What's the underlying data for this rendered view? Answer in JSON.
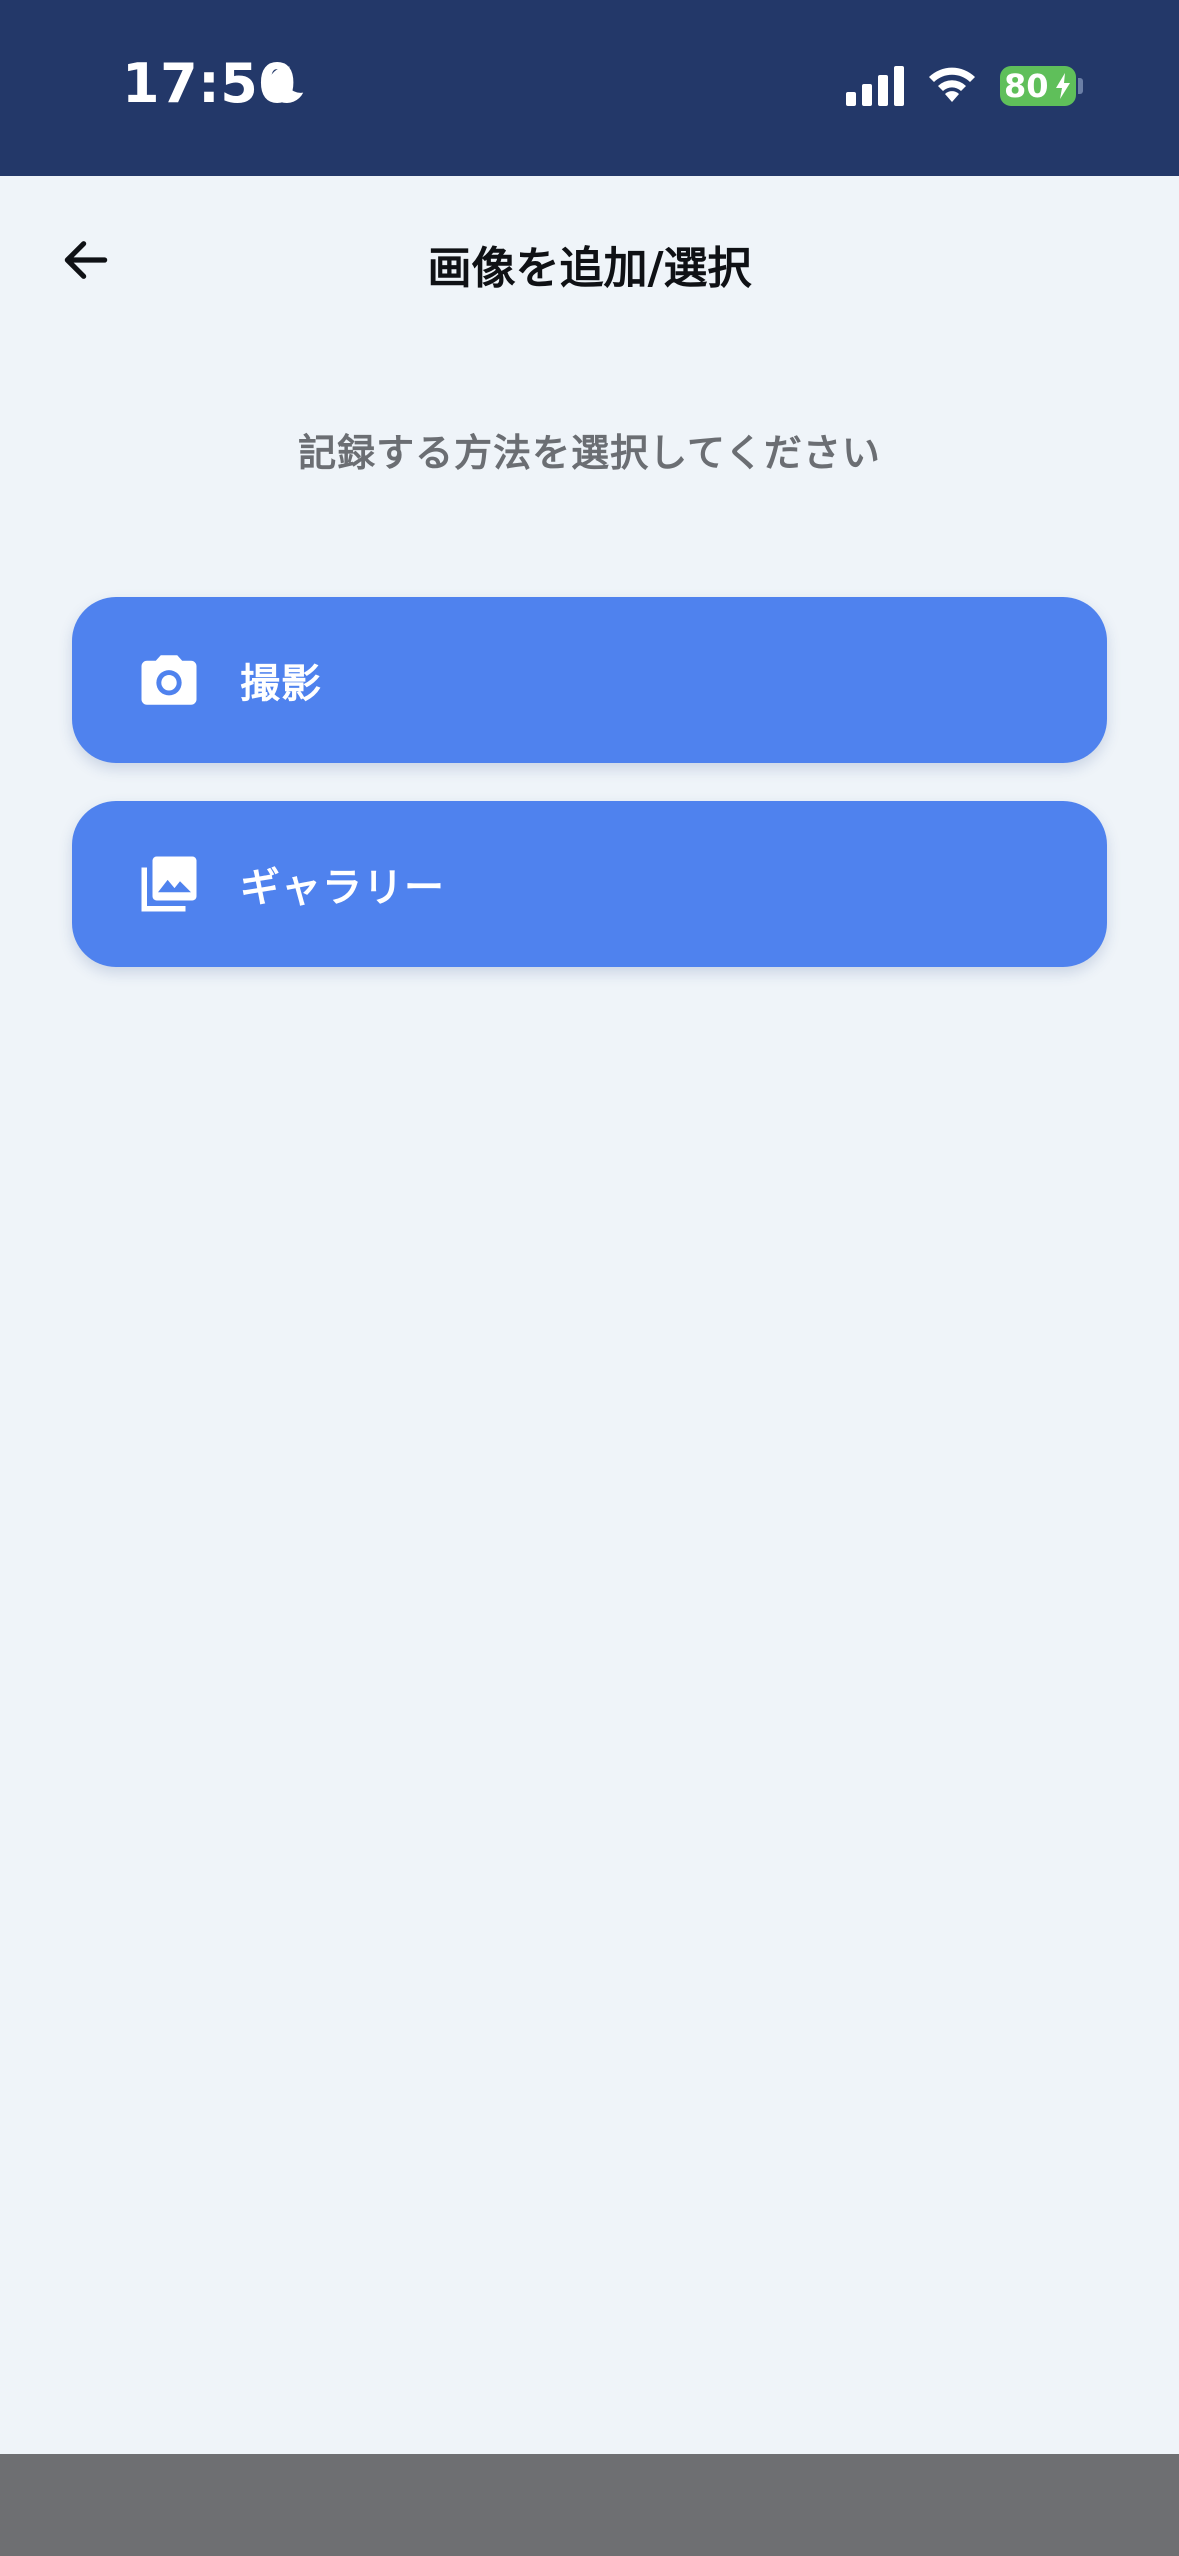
{
  "status_bar": {
    "time": "17:50",
    "battery_level": "80",
    "icons": [
      "moon-icon",
      "signal-icon",
      "wifi-icon",
      "battery-icon"
    ]
  },
  "header": {
    "title": "画像を追加/選択",
    "back_icon": "arrow-left-icon"
  },
  "main": {
    "subtitle": "記録する方法を選択してください",
    "options": [
      {
        "label": "撮影",
        "icon": "camera-icon"
      },
      {
        "label": "ギャラリー",
        "icon": "gallery-icon"
      }
    ]
  },
  "colors": {
    "status_bar_bg": "#233869",
    "page_bg": "#eff4f9",
    "button_bg": "#4f82ee",
    "battery_green": "#5fbf5a",
    "bottom_bar": "#6e6f72"
  }
}
